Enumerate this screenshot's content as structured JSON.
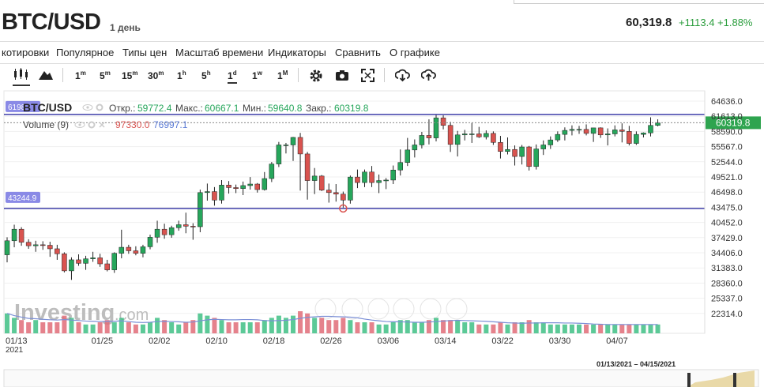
{
  "header": {
    "symbol": "BTC/USD",
    "period": "1 день",
    "price": "60,319.8",
    "change": "+1113.4 +1.88%"
  },
  "menu": [
    "котировки",
    "Популярное",
    "Типы цен",
    "Масштаб времени",
    "Индикаторы",
    "Сравнить",
    "О графике"
  ],
  "toolbar": {
    "intervals": [
      {
        "main": "1",
        "sup": "m"
      },
      {
        "main": "5",
        "sup": "m"
      },
      {
        "main": "15",
        "sup": "m"
      },
      {
        "main": "30",
        "sup": "m"
      },
      {
        "main": "1",
        "sup": "h"
      },
      {
        "main": "5",
        "sup": "h"
      },
      {
        "main": "1",
        "sup": "d"
      },
      {
        "main": "1",
        "sup": "w"
      },
      {
        "main": "1",
        "sup": "M"
      }
    ],
    "selected_interval": "1d",
    "icons": [
      "candlestick-icon",
      "mountain-icon",
      "gear-icon",
      "camera-icon",
      "fullscreen-icon",
      "download-icon",
      "upload-icon"
    ]
  },
  "legend": {
    "symbol": "BTC/USD",
    "open_label": "Откр.:",
    "open": "59772.4",
    "high_label": "Макс.:",
    "high": "60667.1",
    "low_label": "Мин.:",
    "low": "59640.8",
    "close_label": "Закр.:",
    "close": "60319.8",
    "volume_label": "Volume (9)",
    "volume_red": "97330.0",
    "volume_blue": "76997.1"
  },
  "levels": {
    "upper_tag": "6198",
    "upper": 61980,
    "lower_tag": "43244.9",
    "lower": 43244.9
  },
  "last_price_tag": "60319.8",
  "watermark": {
    "brand": "Investing",
    "suffix": ".com"
  },
  "navigator": {
    "range": "01/13/2021 – 04/15/2021"
  },
  "colors": {
    "up": "#26a65b",
    "down": "#d9534f",
    "level": "#3f3fa8",
    "tag": "#8a8ae6",
    "last": "#2ea44f"
  },
  "chart_data": {
    "type": "candlestick",
    "title": "BTC/USD",
    "ylim": [
      20000,
      66000
    ],
    "y_ticks": [
      "64636.0",
      "61613.0",
      "58590.0",
      "55567.0",
      "52544.0",
      "49521.0",
      "46498.0",
      "43475.0",
      "40452.0",
      "37429.0",
      "34406.0",
      "31383.0",
      "28360.0",
      "25337.0",
      "22314.0"
    ],
    "x_ticks": [
      "01/13",
      "01/25",
      "02/02",
      "02/10",
      "02/18",
      "02/26",
      "03/06",
      "03/14",
      "03/22",
      "03/30",
      "04/07"
    ],
    "x_year": "2021",
    "candles": [
      [
        34000,
        37500,
        32500,
        36800
      ],
      [
        36800,
        40000,
        35500,
        39100
      ],
      [
        39100,
        39500,
        35800,
        36500
      ],
      [
        36500,
        37100,
        35200,
        35800
      ],
      [
        35800,
        36800,
        34600,
        36000
      ],
      [
        36000,
        36700,
        35000,
        35900
      ],
      [
        35900,
        36600,
        33600,
        35200
      ],
      [
        35200,
        36000,
        33000,
        34200
      ],
      [
        34200,
        34500,
        30500,
        30800
      ],
      [
        30800,
        33500,
        29000,
        33000
      ],
      [
        33000,
        34100,
        31800,
        32300
      ],
      [
        32300,
        33800,
        31000,
        33200
      ],
      [
        33200,
        34600,
        32600,
        33400
      ],
      [
        33400,
        34200,
        31600,
        32200
      ],
      [
        32200,
        33000,
        30700,
        31000
      ],
      [
        31000,
        34500,
        30400,
        34300
      ],
      [
        34300,
        39000,
        33300,
        35500
      ],
      [
        35500,
        36000,
        34200,
        34800
      ],
      [
        34800,
        35700,
        33900,
        34300
      ],
      [
        34300,
        36000,
        33500,
        35600
      ],
      [
        35600,
        38000,
        35100,
        37500
      ],
      [
        37500,
        40800,
        36400,
        39100
      ],
      [
        39100,
        40200,
        37200,
        38000
      ],
      [
        38000,
        39800,
        37400,
        39400
      ],
      [
        39400,
        40800,
        38800,
        40000
      ],
      [
        40000,
        42400,
        38300,
        39700
      ],
      [
        39700,
        40300,
        37000,
        39600
      ],
      [
        39600,
        47000,
        38500,
        46400
      ],
      [
        46400,
        48200,
        44800,
        46600
      ],
      [
        46600,
        47500,
        43800,
        44900
      ],
      [
        44900,
        48900,
        44200,
        47900
      ],
      [
        47900,
        48700,
        46200,
        47400
      ],
      [
        47400,
        48000,
        46300,
        47200
      ],
      [
        47200,
        48600,
        45900,
        47800
      ],
      [
        47800,
        49500,
        47000,
        48100
      ],
      [
        48100,
        48300,
        46400,
        47000
      ],
      [
        47000,
        50500,
        46800,
        49200
      ],
      [
        49200,
        52500,
        48500,
        52100
      ],
      [
        52100,
        56500,
        51500,
        55900
      ],
      [
        55900,
        56300,
        54200,
        55900
      ],
      [
        55900,
        57500,
        52700,
        57400
      ],
      [
        57400,
        58300,
        46800,
        54100
      ],
      [
        54100,
        54500,
        45000,
        48800
      ],
      [
        48800,
        51300,
        46100,
        49700
      ],
      [
        49700,
        49900,
        46700,
        46900
      ],
      [
        46900,
        48200,
        44400,
        46400
      ],
      [
        46400,
        48100,
        44600,
        46100
      ],
      [
        46100,
        46600,
        43400,
        44900
      ],
      [
        44900,
        49800,
        44200,
        49500
      ],
      [
        49500,
        51000,
        47300,
        48400
      ],
      [
        48400,
        51000,
        47500,
        50500
      ],
      [
        50500,
        51700,
        47500,
        48400
      ],
      [
        48400,
        50000,
        46300,
        48800
      ],
      [
        48800,
        49300,
        47100,
        48900
      ],
      [
        48900,
        51800,
        48100,
        50900
      ],
      [
        50900,
        55000,
        49800,
        52400
      ],
      [
        52400,
        57300,
        51700,
        54900
      ],
      [
        54900,
        57000,
        53400,
        55900
      ],
      [
        55900,
        58500,
        55200,
        57800
      ],
      [
        57800,
        61000,
        56000,
        57300
      ],
      [
        57300,
        62000,
        56600,
        61300
      ],
      [
        61300,
        61800,
        59000,
        59800
      ],
      [
        59800,
        60500,
        54500,
        56000
      ],
      [
        56000,
        58700,
        53600,
        57900
      ],
      [
        57900,
        58900,
        56800,
        58100
      ],
      [
        58100,
        60300,
        56300,
        58100
      ],
      [
        58100,
        59500,
        57300,
        57500
      ],
      [
        57500,
        58800,
        57000,
        58200
      ],
      [
        58200,
        58600,
        55900,
        56400
      ],
      [
        56400,
        57700,
        53200,
        54600
      ],
      [
        54600,
        57400,
        54000,
        55000
      ],
      [
        55000,
        55800,
        51800,
        53600
      ],
      [
        53600,
        55900,
        52000,
        55500
      ],
      [
        55500,
        55700,
        50800,
        51600
      ],
      [
        51600,
        56000,
        51000,
        55100
      ],
      [
        55100,
        56800,
        53900,
        55900
      ],
      [
        55900,
        57600,
        55100,
        56900
      ],
      [
        56900,
        58600,
        56500,
        58000
      ],
      [
        58000,
        59400,
        56800,
        58800
      ],
      [
        58800,
        59800,
        57800,
        59000
      ],
      [
        59000,
        59700,
        58100,
        59000
      ],
      [
        59000,
        60000,
        57800,
        58200
      ],
      [
        58200,
        59300,
        56500,
        59300
      ],
      [
        59300,
        59400,
        57300,
        57900
      ],
      [
        57900,
        59200,
        55800,
        58100
      ],
      [
        58100,
        59800,
        57600,
        58900
      ],
      [
        58900,
        60200,
        56400,
        58600
      ],
      [
        58600,
        59700,
        55800,
        56200
      ],
      [
        56200,
        58600,
        55900,
        58000
      ],
      [
        58000,
        58400,
        57400,
        58300
      ],
      [
        58300,
        61400,
        57600,
        59800
      ],
      [
        59800,
        61000,
        59600,
        60300
      ]
    ],
    "volumes": [
      9,
      7,
      6,
      5,
      6,
      5,
      5,
      5,
      8,
      7,
      5,
      4,
      4,
      5,
      6,
      5,
      7,
      5,
      4,
      4,
      5,
      7,
      6,
      5,
      4,
      5,
      6,
      9,
      8,
      7,
      6,
      5,
      5,
      5,
      5,
      5,
      6,
      7,
      8,
      7,
      8,
      10,
      9,
      7,
      7,
      6,
      6,
      7,
      6,
      5,
      5,
      5,
      4,
      4,
      5,
      6,
      6,
      5,
      5,
      6,
      7,
      6,
      6,
      6,
      5,
      5,
      4,
      4,
      4,
      5,
      4,
      5,
      5,
      6,
      5,
      5,
      4,
      4,
      4,
      4,
      4,
      4,
      4,
      4,
      4,
      4,
      4,
      4,
      4,
      4,
      4,
      4
    ]
  }
}
